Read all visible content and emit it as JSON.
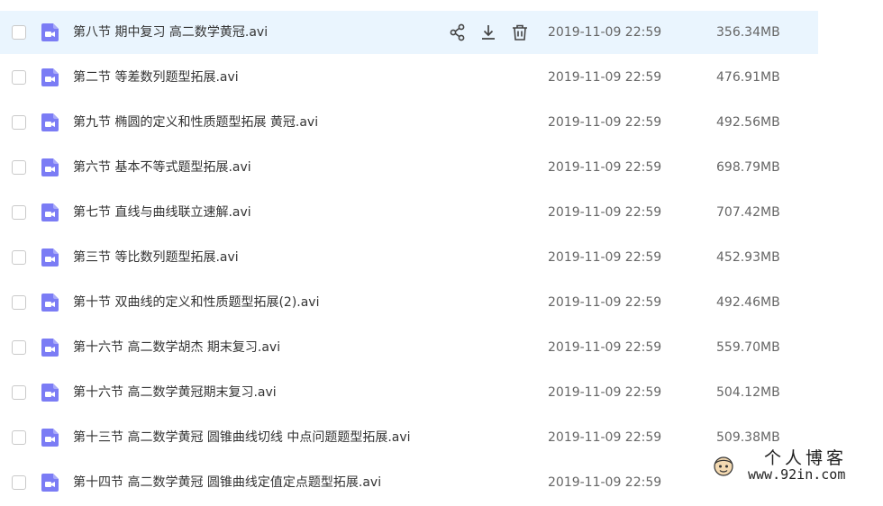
{
  "colors": {
    "hover_row": "#eaf5fe",
    "video_icon": "#7b7cf5",
    "text": "#333333",
    "muted_text": "#666666"
  },
  "icons": {
    "file_type": "video-file-icon",
    "row_actions": [
      "share-icon",
      "download-icon",
      "delete-icon"
    ]
  },
  "files": [
    {
      "name": "第八节 期中复习 高二数学黄冠.avi",
      "date": "2019-11-09 22:59",
      "size": "356.34MB",
      "hovered": true
    },
    {
      "name": "第二节 等差数列题型拓展.avi",
      "date": "2019-11-09 22:59",
      "size": "476.91MB"
    },
    {
      "name": "第九节 椭圆的定义和性质题型拓展 黄冠.avi",
      "date": "2019-11-09 22:59",
      "size": "492.56MB"
    },
    {
      "name": "第六节 基本不等式题型拓展.avi",
      "date": "2019-11-09 22:59",
      "size": "698.79MB"
    },
    {
      "name": "第七节 直线与曲线联立速解.avi",
      "date": "2019-11-09 22:59",
      "size": "707.42MB"
    },
    {
      "name": "第三节 等比数列题型拓展.avi",
      "date": "2019-11-09 22:59",
      "size": "452.93MB"
    },
    {
      "name": "第十节 双曲线的定义和性质题型拓展(2).avi",
      "date": "2019-11-09 22:59",
      "size": "492.46MB"
    },
    {
      "name": "第十六节 高二数学胡杰 期末复习.avi",
      "date": "2019-11-09 22:59",
      "size": "559.70MB"
    },
    {
      "name": "第十六节 高二数学黄冠期末复习.avi",
      "date": "2019-11-09 22:59",
      "size": "504.12MB"
    },
    {
      "name": "第十三节 高二数学黄冠 圆锥曲线切线 中点问题题型拓展.avi",
      "date": "2019-11-09 22:59",
      "size": "509.38MB"
    },
    {
      "name": "第十四节 高二数学黄冠 圆锥曲线定值定点题型拓展.avi",
      "date": "2019-11-09 22:59",
      "size": ""
    }
  ],
  "watermark": {
    "title": "个人博客",
    "url": "www.92in.com"
  }
}
